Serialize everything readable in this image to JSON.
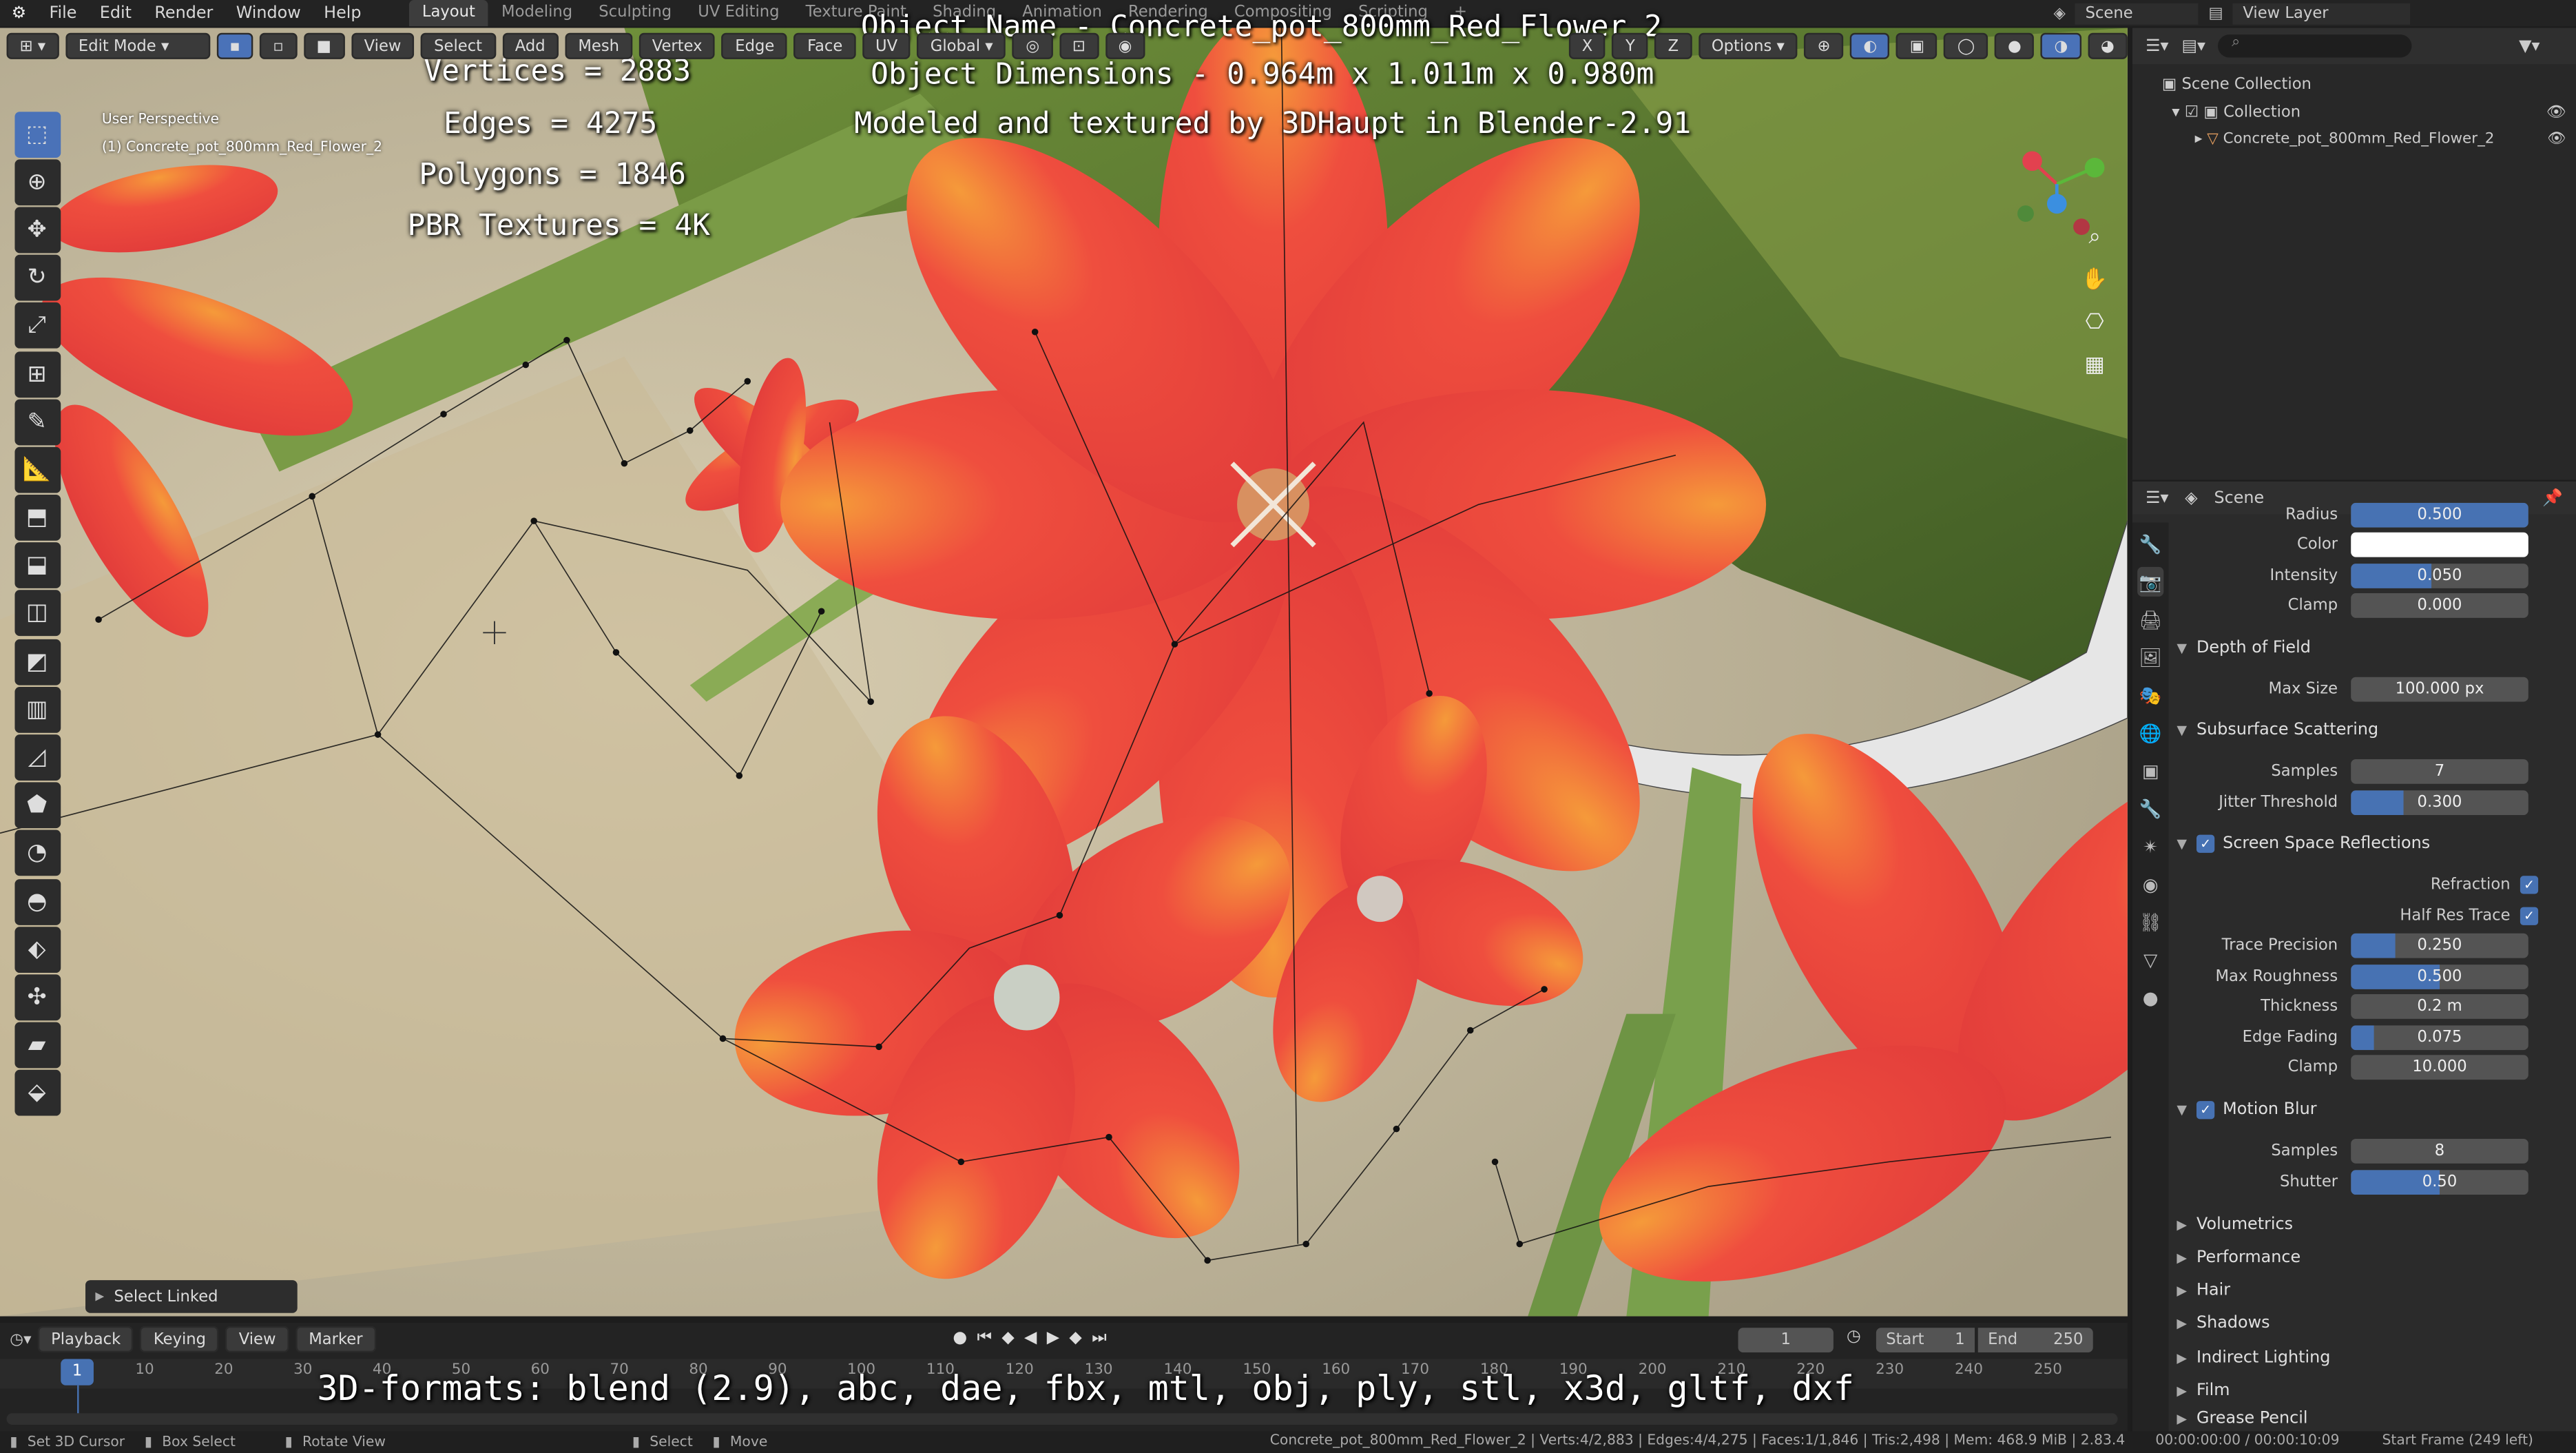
{
  "topbar": {
    "menu": [
      "File",
      "Edit",
      "Render",
      "Window",
      "Help"
    ],
    "workspaces": [
      "Layout",
      "Modeling",
      "Sculpting",
      "UV Editing",
      "Texture Paint",
      "Shading",
      "Animation",
      "Rendering",
      "Compositing",
      "Scripting"
    ],
    "active_workspace": "Layout",
    "add_workspace": "+",
    "scene_label": "Scene",
    "view_layer_label": "View Layer"
  },
  "viewport_header": {
    "mode": "Edit Mode",
    "menus": [
      "View",
      "Select",
      "Add",
      "Mesh",
      "Vertex",
      "Edge",
      "Face",
      "UV"
    ],
    "transform_orientation": "Global",
    "axes": [
      "X",
      "Y",
      "Z"
    ],
    "options_label": "Options"
  },
  "viewport": {
    "perspective": "User Perspective",
    "object_info": "(1) Concrete_pot_800mm_Red_Flower_2",
    "stats": [
      "Vertices = 2883",
      "Edges = 4275",
      "Polygons = 1846",
      "PBR Textures = 4K"
    ],
    "title_lines": [
      "Object Name - Concrete_pot_800mm_Red_Flower_2",
      "Object Dimensions -  0.964m x 1.011m x 0.980m",
      "Modeled and textured by 3DHaupt in Blender-2.91"
    ],
    "formats": "3D-formats: blend (2.9), abc, dae, fbx, mtl, obj, ply, stl, x3d, gltf, dxf",
    "last_operator": "Select Linked",
    "gizmo_colors": {
      "x": "#e2414f",
      "y": "#5bb83a",
      "z": "#3b8fe0"
    }
  },
  "outliner": {
    "root": "Scene Collection",
    "collection": "Collection",
    "object": "Concrete_pot_800mm_Red_Flower_2"
  },
  "properties": {
    "context": "Scene",
    "top_rows": [
      {
        "label": "Radius",
        "value": "0.500",
        "fill": 1.0
      },
      {
        "label": "Color",
        "value": "",
        "fill": 0,
        "white": true
      },
      {
        "label": "Intensity",
        "value": "0.050",
        "fill": 0.45
      },
      {
        "label": "Clamp",
        "value": "0.000",
        "fill": 0
      }
    ],
    "dof": {
      "title": "Depth of Field",
      "rows": [
        {
          "label": "Max Size",
          "value": "100.000 px",
          "fill": 0
        }
      ]
    },
    "sss": {
      "title": "Subsurface Scattering",
      "rows": [
        {
          "label": "Samples",
          "value": "7",
          "fill": 0
        },
        {
          "label": "Jitter Threshold",
          "value": "0.300",
          "fill": 0.3
        }
      ]
    },
    "ssr": {
      "title": "Screen Space Reflections",
      "refraction": "Refraction",
      "half_res": "Half Res Trace",
      "rows": [
        {
          "label": "Trace Precision",
          "value": "0.250",
          "fill": 0.25
        },
        {
          "label": "Max Roughness",
          "value": "0.500",
          "fill": 0.5
        },
        {
          "label": "Thickness",
          "value": "0.2 m",
          "fill": 0
        },
        {
          "label": "Edge Fading",
          "value": "0.075",
          "fill": 0.15
        },
        {
          "label": "Clamp",
          "value": "10.000",
          "fill": 0
        }
      ]
    },
    "motion_blur": {
      "title": "Motion Blur",
      "rows": [
        {
          "label": "Samples",
          "value": "8",
          "fill": 0
        },
        {
          "label": "Shutter",
          "value": "0.50",
          "fill": 0.5
        }
      ]
    },
    "collapsed": [
      "Volumetrics",
      "Performance",
      "Hair",
      "Shadows",
      "Indirect Lighting",
      "Film",
      "Grease Pencil"
    ]
  },
  "timeline": {
    "menus": [
      "Playback",
      "Keying",
      "View",
      "Marker"
    ],
    "current_frame": "1",
    "start_label": "Start",
    "start": "1",
    "end_label": "End",
    "end": "250",
    "ruler": [
      "1",
      "10",
      "20",
      "30",
      "40",
      "50",
      "60",
      "70",
      "80",
      "90",
      "100",
      "110",
      "120",
      "130",
      "140",
      "150",
      "160",
      "170",
      "180",
      "190",
      "200",
      "210",
      "220",
      "230",
      "240",
      "250"
    ]
  },
  "statusbar": {
    "left": [
      "Set 3D Cursor",
      "Box Select",
      "Rotate View",
      "Select",
      "Move"
    ],
    "right": "Concrete_pot_800mm_Red_Flower_2 | Verts:4/2,883 | Edges:4/4,275 | Faces:1/1,846 | Tris:2,498 | Mem: 468.9 MiB | 2.83.4",
    "time": "00:00:00:00 / 00:00:10:09",
    "start_frame": "Start Frame (249 left)"
  }
}
